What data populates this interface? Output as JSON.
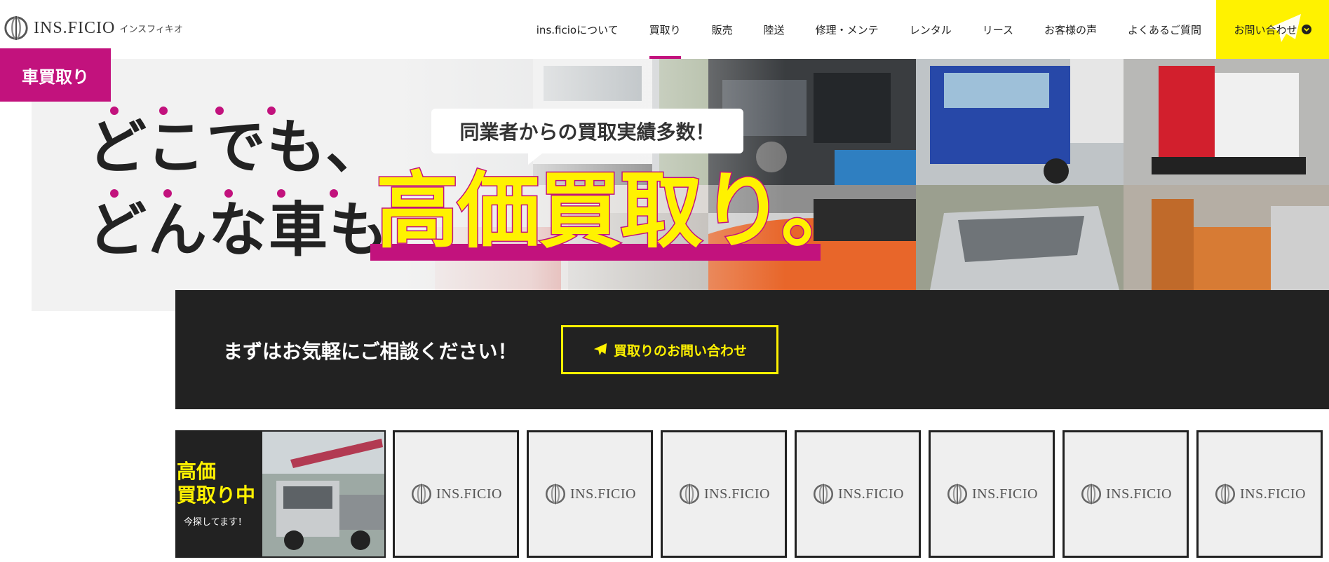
{
  "header": {
    "logo_text": "INS.FICIO",
    "logo_sub": "インスフィキオ",
    "nav": [
      {
        "label": "ins.ficioについて",
        "active": false
      },
      {
        "label": "買取り",
        "active": true
      },
      {
        "label": "販売",
        "active": false
      },
      {
        "label": "陸送",
        "active": false
      },
      {
        "label": "修理・メンテ",
        "active": false
      },
      {
        "label": "レンタル",
        "active": false
      },
      {
        "label": "リース",
        "active": false
      },
      {
        "label": "お客様の声",
        "active": false
      },
      {
        "label": "よくあるご質問",
        "active": false
      }
    ],
    "contact_label": "お問い合わせ",
    "accent": "#fff200"
  },
  "hero": {
    "tag": "車買取り",
    "line1": "どこでも、",
    "line2": "どんな車も",
    "bubble": "同業者からの買取実績多数！",
    "big": "高価買取り。",
    "brand_color": "#c2127d"
  },
  "cta": {
    "text": "まずはお気軽にご相談ください！",
    "button": "買取りのお問い合わせ"
  },
  "feature": {
    "line1": "高価",
    "line2": "買取り中",
    "sub": "今探してます！"
  },
  "thumbnails": [
    {
      "logo": "INS.FICIO"
    },
    {
      "logo": "INS.FICIO"
    },
    {
      "logo": "INS.FICIO"
    },
    {
      "logo": "INS.FICIO"
    },
    {
      "logo": "INS.FICIO"
    },
    {
      "logo": "INS.FICIO"
    },
    {
      "logo": "INS.FICIO"
    }
  ]
}
